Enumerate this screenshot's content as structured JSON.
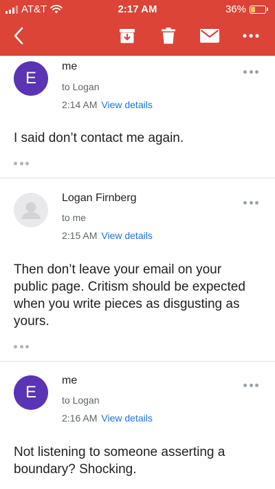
{
  "status_bar": {
    "carrier": "AT&T",
    "time": "2:17 AM",
    "battery": "36%",
    "battery_level": 0.36
  },
  "toolbar": {
    "back_icon": "back-arrow-icon",
    "archive_icon": "archive-icon",
    "delete_icon": "trash-icon",
    "mark_unread_icon": "envelope-icon",
    "more_icon": "more-horizontal-icon",
    "color": "#db4437"
  },
  "messages": [
    {
      "avatar_letter": "E",
      "avatar_color": "#5a34b4",
      "sender": "me",
      "recipient": "to Logan",
      "time": "2:14 AM",
      "details_link": "View details",
      "body": "I said don’t contact me again."
    },
    {
      "avatar_letter": "",
      "avatar_color": "#e9e9ec",
      "sender": "Logan Firnberg",
      "recipient": "to me",
      "time": "2:15 AM",
      "details_link": "View details",
      "body": "Then don’t leave your email on your public page. Critism should be expected when you write pieces as disgusting as yours."
    },
    {
      "avatar_letter": "E",
      "avatar_color": "#5a34b4",
      "sender": "me",
      "recipient": "to Logan",
      "time": "2:16 AM",
      "details_link": "View details",
      "body": "Not listening to someone asserting a boundary? Shocking."
    }
  ],
  "colors": {
    "link": "#1a73e8",
    "secondary_text": "#5f6368",
    "divider": "#e0e0e0"
  }
}
